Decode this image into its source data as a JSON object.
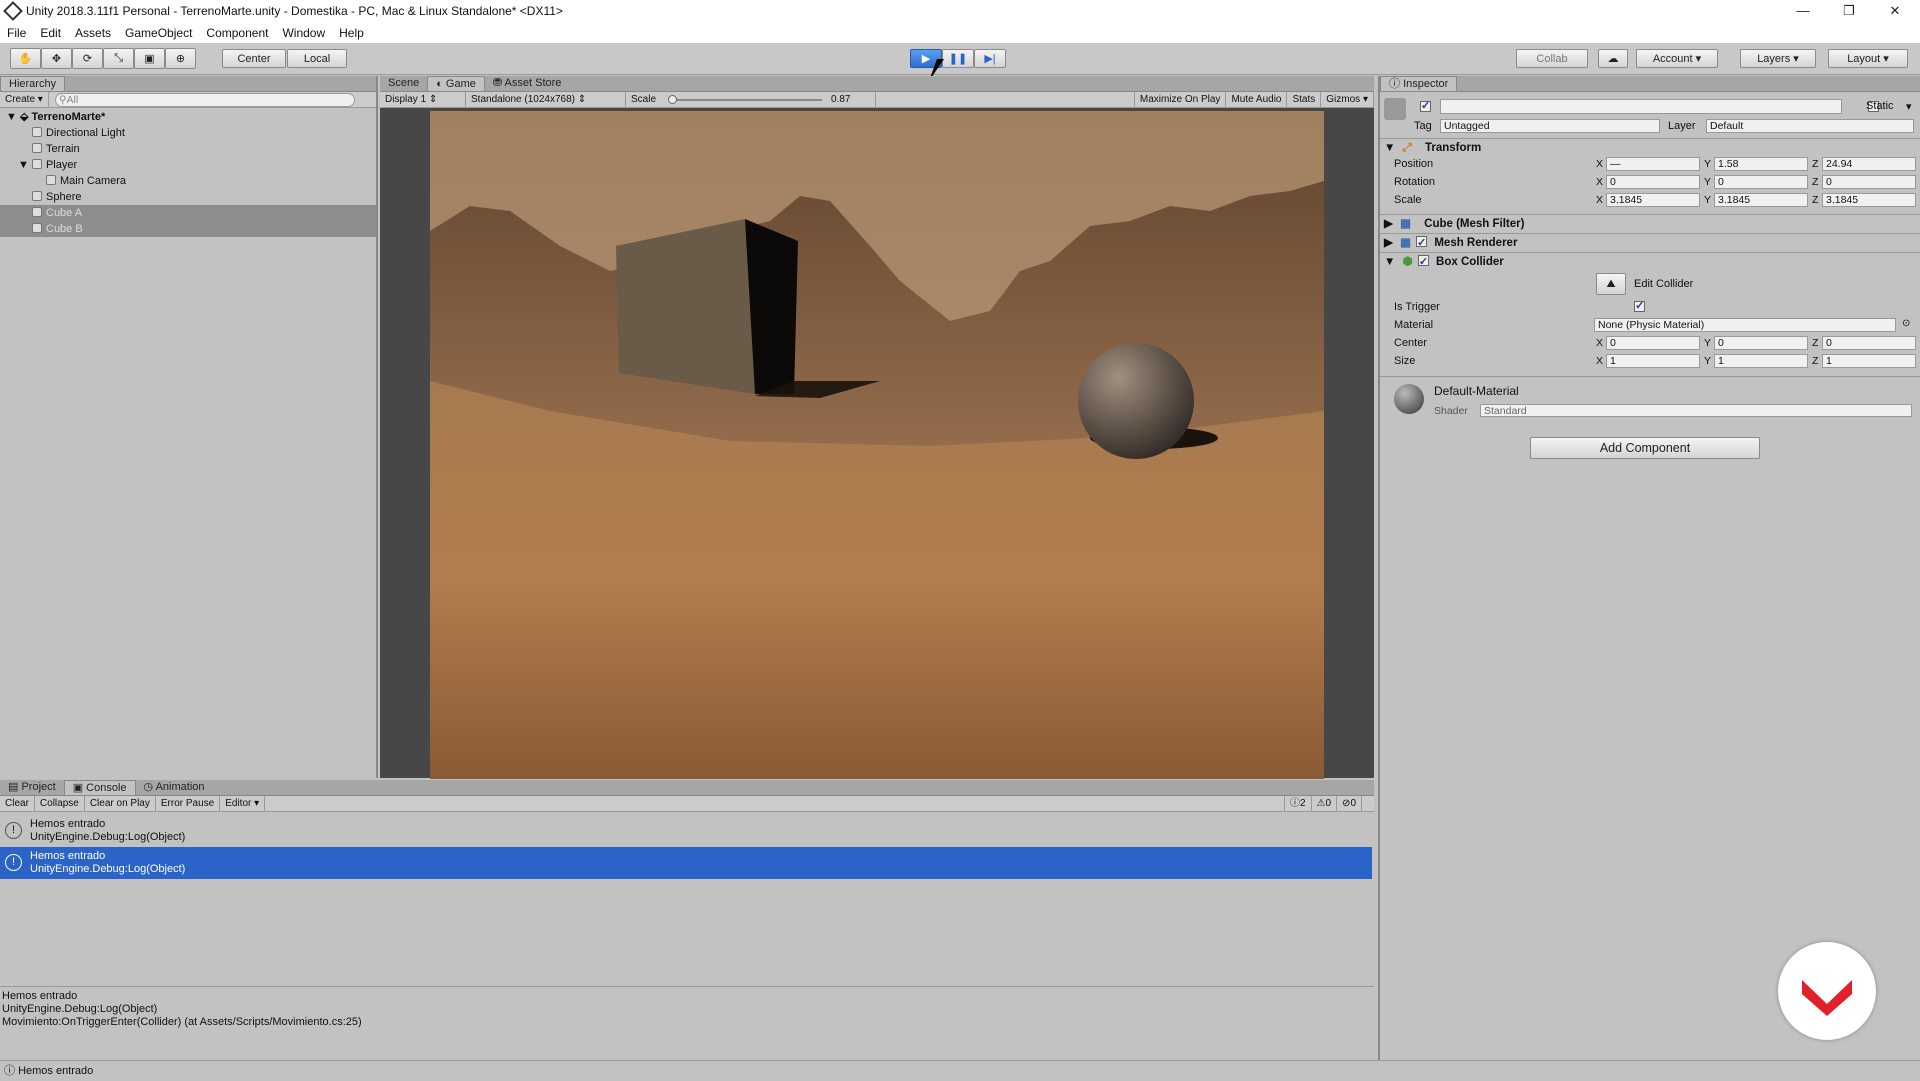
{
  "window": {
    "title": "Unity 2018.3.11f1 Personal - TerrenoMarte.unity - Domestika - PC, Mac & Linux Standalone* <DX11>"
  },
  "menu": [
    "File",
    "Edit",
    "Assets",
    "GameObject",
    "Component",
    "Window",
    "Help"
  ],
  "toolbar": {
    "pivot": "Center",
    "space": "Local",
    "collab": "Collab",
    "account": "Account",
    "layers": "Layers",
    "layout": "Layout",
    "tools": [
      "hand-icon",
      "move-icon",
      "rotate-icon",
      "scale-icon",
      "rect-icon",
      "transform-icon"
    ]
  },
  "hierarchy": {
    "tab": "Hierarchy",
    "create": "Create",
    "search_placeholder": "All",
    "scene": "TerrenoMarte*",
    "items": [
      {
        "label": "Directional Light",
        "depth": 1
      },
      {
        "label": "Terrain",
        "depth": 1
      },
      {
        "label": "Player",
        "depth": 1
      },
      {
        "label": "Main Camera",
        "depth": 2
      },
      {
        "label": "Sphere",
        "depth": 1
      },
      {
        "label": "Cube A",
        "depth": 1
      },
      {
        "label": "Cube B",
        "depth": 1
      }
    ]
  },
  "center": {
    "tabs": [
      "Scene",
      "Game",
      "Asset Store"
    ],
    "display": "Display 1",
    "resolution": "Standalone (1024x768)",
    "scale_label": "Scale",
    "scale_value": "0.87",
    "buttons": [
      "Maximize On Play",
      "Mute Audio",
      "Stats",
      "Gizmos"
    ]
  },
  "inspector": {
    "tab": "Inspector",
    "object_name": "",
    "static_label": "Static",
    "tag_label": "Tag",
    "tag": "Untagged",
    "layer_label": "Layer",
    "layer": "Default",
    "transform": {
      "title": "Transform",
      "position_label": "Position",
      "position": [
        "—",
        "1.58",
        "24.94"
      ],
      "rotation_label": "Rotation",
      "rotation": [
        "0",
        "0",
        "0"
      ],
      "scale_label": "Scale",
      "scale": [
        "3.1845",
        "3.1845",
        "3.1845"
      ]
    },
    "mesh_filter": "Cube (Mesh Filter)",
    "mesh_renderer": "Mesh Renderer",
    "box_collider": {
      "title": "Box Collider",
      "edit": "Edit Collider",
      "is_trigger_label": "Is Trigger",
      "material_label": "Material",
      "material": "None (Physic Material)",
      "center_label": "Center",
      "center": [
        "0",
        "0",
        "0"
      ],
      "size_label": "Size",
      "size": [
        "1",
        "1",
        "1"
      ]
    },
    "material": {
      "name": "Default-Material",
      "shader_label": "Shader",
      "shader": "Standard"
    },
    "add_component": "Add Component"
  },
  "console": {
    "tabs": [
      "Project",
      "Console",
      "Animation"
    ],
    "buttons": [
      "Clear",
      "Collapse",
      "Clear on Play",
      "Error Pause",
      "Editor"
    ],
    "counts": [
      "2",
      "0",
      "0"
    ],
    "logs": [
      {
        "line1": "Hemos entrado",
        "line2": "UnityEngine.Debug:Log(Object)"
      },
      {
        "line1": "Hemos entrado",
        "line2": "UnityEngine.Debug:Log(Object)"
      }
    ],
    "detail": [
      "Hemos entrado",
      "UnityEngine.Debug:Log(Object)",
      "Movimiento:OnTriggerEnter(Collider) (at Assets/Scripts/Movimiento.cs:25)"
    ]
  },
  "status": "Hemos entrado",
  "colors": {
    "selection": "#2a64c8",
    "play_active": "#3a7ee0",
    "brand": "#e0202a"
  }
}
